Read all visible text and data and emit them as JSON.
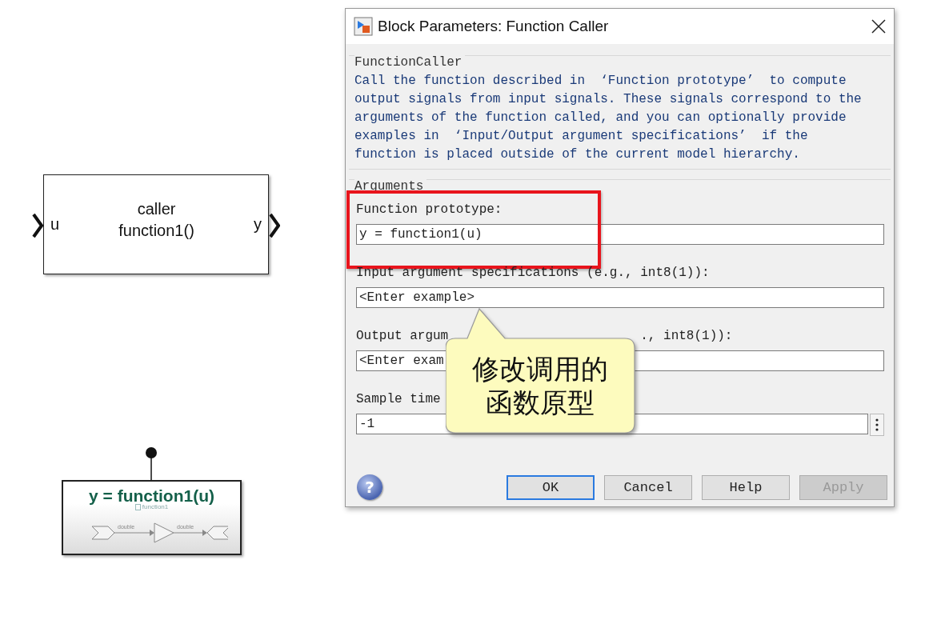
{
  "canvas": {
    "caller_block": {
      "title": "caller",
      "call": "function1()",
      "input_port": "u",
      "output_port": "y"
    },
    "function_block": {
      "title": "y = function1(u)",
      "subsystem_label": "function1",
      "signal_labels": [
        "double",
        "double"
      ]
    }
  },
  "dialog": {
    "title": "Block Parameters: Function Caller",
    "description_group": {
      "legend": "FunctionCaller",
      "text": "Call the function described in  ‘Function prototype’  to compute output signals from input signals. These signals correspond to the arguments of the function called, and you can optionally provide examples in  ‘Input/Output argument specifications’  if the function is placed outside of the current model hierarchy."
    },
    "arguments_group": {
      "legend": "Arguments",
      "fields": [
        {
          "label": "Function prototype:",
          "value": "y = function1(u)",
          "highlighted": true,
          "has_menu": false
        },
        {
          "label": "Input argument specifications (e.g., int8(1)):",
          "value": "<Enter example>",
          "highlighted": false,
          "has_menu": false
        },
        {
          "label": "Output argum",
          "label_tail": "., int8(1)):",
          "value": "<Enter exam",
          "highlighted": false,
          "has_menu": false
        },
        {
          "label": "Sample time",
          "value": "-1",
          "highlighted": false,
          "has_menu": true
        }
      ]
    },
    "help_glyph": "?",
    "buttons": [
      {
        "label": "OK",
        "kind": "default",
        "disabled": false
      },
      {
        "label": "Cancel",
        "kind": "normal",
        "disabled": false
      },
      {
        "label": "Help",
        "kind": "normal",
        "disabled": false
      },
      {
        "label": "Apply",
        "kind": "normal",
        "disabled": true
      }
    ]
  },
  "annotation": {
    "text": "修改调用的函数原型"
  }
}
